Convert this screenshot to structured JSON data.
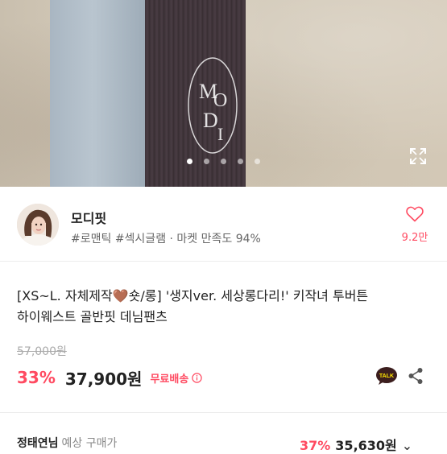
{
  "hero": {
    "logo_text": "MODI",
    "slide_count": 5,
    "active_slide": 1
  },
  "seller": {
    "name": "모디핏",
    "tags": "#로맨틱 #섹시글램 · 마켓 만족도 94%",
    "like_count": "9.2만"
  },
  "product": {
    "title_part1": "[XS~L. 자체제작",
    "title_part2": "숏/롱] '생지ver. 세상롱다리!' 키작녀 투버튼",
    "title_line2": "하이웨스트 골반핏 데님팬츠",
    "original_price": "57,000원",
    "discount": "33%",
    "price": "37,900원",
    "shipping": "무료배송"
  },
  "bottom": {
    "label_bold": "정태연님",
    "label_sub": "예상 구매가",
    "discount": "37%",
    "price": "35,630원"
  },
  "colors": {
    "accent": "#ff4a61",
    "kakao": "#3c1e1e"
  },
  "icons": {
    "expand": "expand-icon",
    "like": "heart-outline-icon",
    "info": "info-circle-icon",
    "talk": "kakao-talk-icon",
    "share": "share-icon",
    "chevron": "chevron-down-icon"
  }
}
